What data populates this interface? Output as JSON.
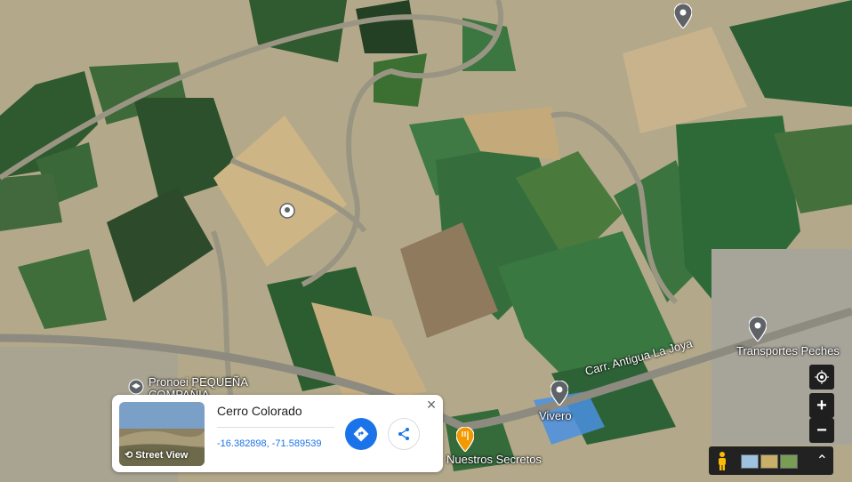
{
  "labels": {
    "pronoei": "Pronoei PEQUEÑA",
    "pronoei2": "COMPAÑIA",
    "vivero": "Vivero",
    "transportes": "Transportes Peches",
    "road": "Carr. Antigua La Joya",
    "nuestros": "Nuestros Secretos"
  },
  "card": {
    "title": "Cerro Colorado",
    "coordinates": "-16.382898, -71.589539",
    "street_view_label": "Street View"
  },
  "controls": {
    "zoom_in": "+",
    "zoom_out": "−",
    "layers_toggle": "⌃"
  },
  "colors": {
    "accent": "#1a73e8",
    "pin": "#5f6368",
    "restaurant_pin": "#f29900"
  }
}
